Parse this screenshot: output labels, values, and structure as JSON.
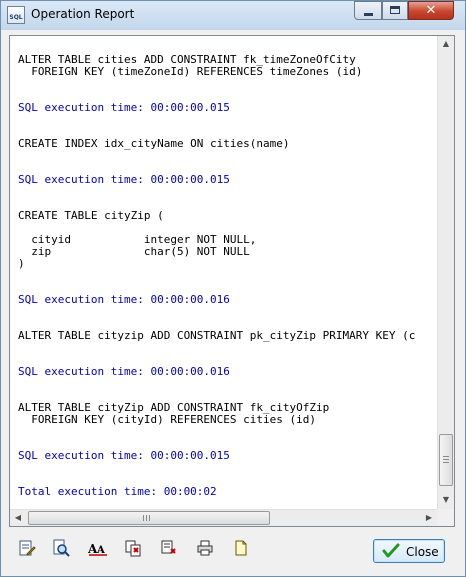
{
  "window": {
    "title": "Operation Report",
    "app_icon_text": "SQL",
    "close_glyph": "✕"
  },
  "report": {
    "lines": [
      {
        "text": "ALTER TABLE cities ADD CONSTRAINT fk_timeZoneOfCity",
        "kind": "sql"
      },
      {
        "text": "  FOREIGN KEY (timeZoneId) REFERENCES timeZones (id)",
        "kind": "sql"
      },
      {
        "text": "SQL execution time: 00:00:00.015",
        "kind": "timing"
      },
      {
        "text": "CREATE INDEX idx_cityName ON cities(name)",
        "kind": "sql"
      },
      {
        "text": "SQL execution time: 00:00:00.015",
        "kind": "timing"
      },
      {
        "text": "CREATE TABLE cityZip (",
        "kind": "sql"
      },
      {
        "text": "  cityid           integer NOT NULL,",
        "kind": "sql"
      },
      {
        "text": "  zip              char(5) NOT NULL",
        "kind": "sql"
      },
      {
        "text": ")",
        "kind": "sql"
      },
      {
        "text": "SQL execution time: 00:00:00.016",
        "kind": "timing"
      },
      {
        "text": "ALTER TABLE cityzip ADD CONSTRAINT pk_cityZip PRIMARY KEY (c",
        "kind": "sql"
      },
      {
        "text": "SQL execution time: 00:00:00.016",
        "kind": "timing"
      },
      {
        "text": "ALTER TABLE cityZip ADD CONSTRAINT fk_cityOfZip",
        "kind": "sql"
      },
      {
        "text": "  FOREIGN KEY (cityId) REFERENCES cities (id)",
        "kind": "sql"
      },
      {
        "text": "SQL execution time: 00:00:00.015",
        "kind": "timing"
      },
      {
        "text": "Total execution time: 00:00:02",
        "kind": "timing"
      }
    ]
  },
  "scroll": {
    "up": "▲",
    "down": "▼",
    "left": "◀",
    "right": "▶"
  },
  "toolbar": {
    "icons": [
      "edit-icon",
      "find-icon",
      "font-icon",
      "copy-icon",
      "save-icon",
      "print-icon",
      "note-icon"
    ]
  },
  "actions": {
    "close_label": "Close"
  },
  "colors": {
    "timing_text": "#0000c0",
    "sql_text": "#000000"
  }
}
